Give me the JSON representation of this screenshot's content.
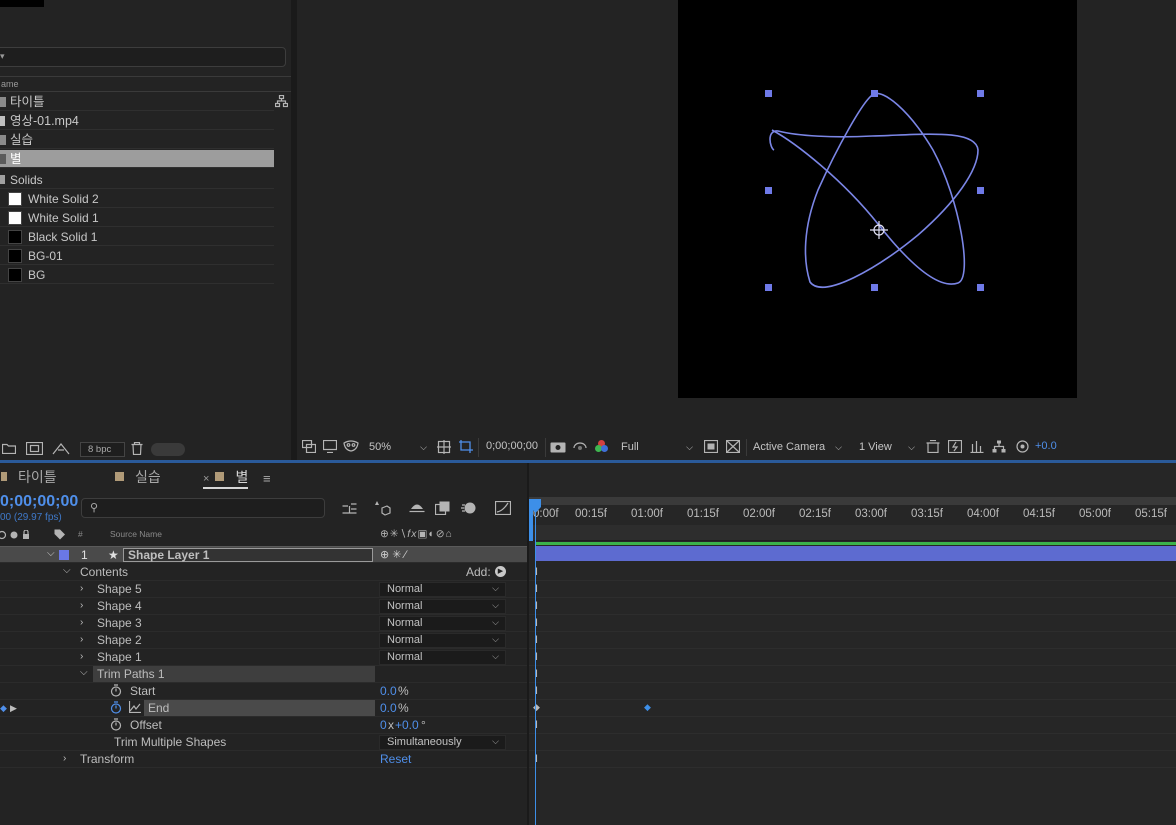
{
  "project": {
    "header_label": "ame",
    "items": [
      {
        "name": "타이틀",
        "type": "comp"
      },
      {
        "name": "영상-01.mp4",
        "type": "footage"
      },
      {
        "name": "실습",
        "type": "comp"
      },
      {
        "name": "별",
        "type": "comp",
        "selected": true
      },
      {
        "name": "Solids",
        "type": "folder"
      },
      {
        "name": "White Solid 2",
        "type": "solid",
        "swatch": "#ffffff"
      },
      {
        "name": "White Solid 1",
        "type": "solid",
        "swatch": "#ffffff"
      },
      {
        "name": "Black Solid 1",
        "type": "solid",
        "swatch": "#000000"
      },
      {
        "name": "BG-01",
        "type": "solid",
        "swatch": "#000000"
      },
      {
        "name": "BG",
        "type": "solid",
        "swatch": "#000000"
      }
    ],
    "bpc": "8 bpc"
  },
  "viewer": {
    "zoom": "50%",
    "timecode": "0;00;00;00",
    "resolution": "Full",
    "camera": "Active Camera",
    "views": "1 View",
    "exposure": "+0.0",
    "shape_color": "#7b86e6"
  },
  "timeline": {
    "tabs": [
      {
        "label": "타이틀"
      },
      {
        "label": "실습"
      },
      {
        "label": "별",
        "active": true
      }
    ],
    "time_code": "0;00;00;00",
    "fps": "00 (29.97 fps)",
    "column_header": {
      "number": "#",
      "source_name": "Source Name"
    },
    "layer": {
      "number": "1",
      "name": "Shape Layer 1"
    },
    "contents_label": "Contents",
    "add_label": "Add:",
    "shapes": [
      {
        "name": "Shape 5",
        "blend": "Normal"
      },
      {
        "name": "Shape 4",
        "blend": "Normal"
      },
      {
        "name": "Shape 3",
        "blend": "Normal"
      },
      {
        "name": "Shape 2",
        "blend": "Normal"
      },
      {
        "name": "Shape 1",
        "blend": "Normal"
      }
    ],
    "trim_paths": {
      "name": "Trim Paths 1",
      "start_label": "Start",
      "start_value": "0.0",
      "start_unit": "%",
      "end_label": "End",
      "end_value": "0.0",
      "end_unit": "%",
      "offset_label": "Offset",
      "offset_revolutions": "0",
      "offset_x": "x",
      "offset_degrees": "+0.0",
      "offset_unit": "°",
      "multiple_label": "Trim Multiple Shapes",
      "multiple_value": "Simultaneously"
    },
    "transform_label": "Transform",
    "reset_label": "Reset",
    "ruler": [
      "0:00f",
      "00:15f",
      "01:00f",
      "01:15f",
      "02:00f",
      "02:15f",
      "03:00f",
      "03:15f",
      "04:00f",
      "04:15f",
      "05:00f",
      "05:15f"
    ],
    "layer_bar_color": "#5d6bd0",
    "playhead_color": "#3d8fe8"
  }
}
